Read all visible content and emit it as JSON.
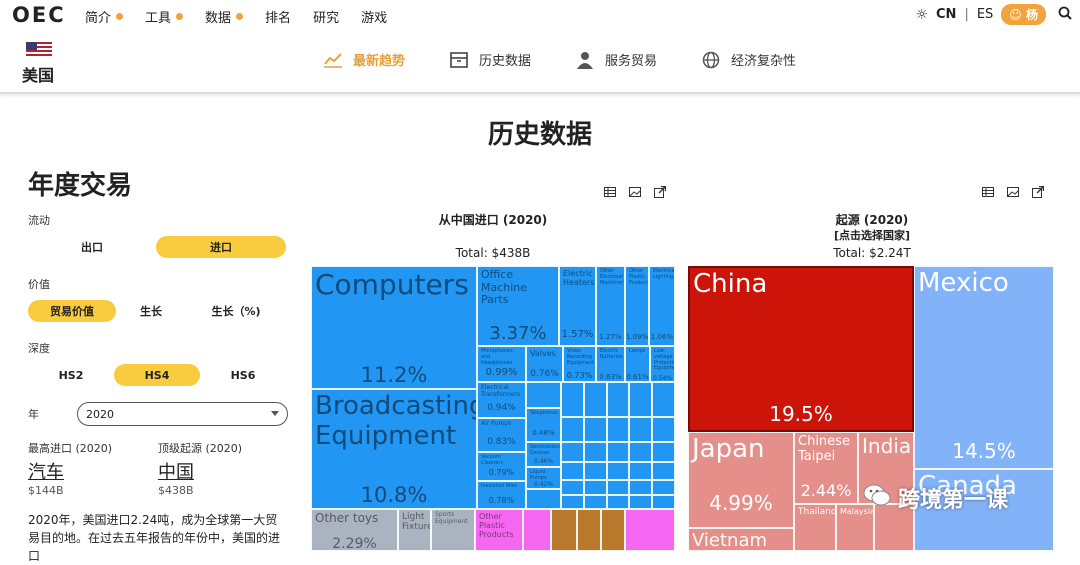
{
  "logo": "OEC",
  "nav": [
    {
      "label": "简介",
      "dot": true
    },
    {
      "label": "工具",
      "dot": true
    },
    {
      "label": "数据",
      "dot": true
    },
    {
      "label": "排名",
      "dot": false
    },
    {
      "label": "研究",
      "dot": false
    },
    {
      "label": "游戏",
      "dot": false
    }
  ],
  "lang": {
    "current": "CN",
    "sep": "|",
    "other": "ES"
  },
  "user": {
    "label": "杨"
  },
  "country": {
    "name": "美国"
  },
  "tabs": [
    {
      "label": "最新趋势",
      "icon": "trend-chart-icon",
      "active": true
    },
    {
      "label": "历史数据",
      "icon": "archive-box-icon",
      "active": false
    },
    {
      "label": "服务贸易",
      "icon": "person-icon",
      "active": false
    },
    {
      "label": "经济复杂性",
      "icon": "globe-icon",
      "active": false
    }
  ],
  "page_title": "历史数据",
  "sidebar": {
    "heading": "年度交易",
    "flow_label": "流动",
    "flow_options": [
      "出口",
      "进口"
    ],
    "value_label": "价值",
    "value_options": [
      "贸易价值",
      "生长",
      "生长（%)"
    ],
    "depth_label": "深度",
    "depth_options": [
      "HS2",
      "HS4",
      "HS6"
    ],
    "year_label": "年",
    "year_value": "2020",
    "top_import_label": "最高进口 (2020)",
    "top_import_value": "汽车",
    "top_import_amount": "$144B",
    "top_origin_label": "顶级起源 (2020)",
    "top_origin_value": "中国",
    "top_origin_amount": "$438B",
    "paragraph": "2020年，美国进口2.24吨，成为全球第一大贸易目的地。在过去五年报告的年份中，美国的进口"
  },
  "chart1": {
    "title": "从中国进口 (2020)",
    "total": "Total: $438B"
  },
  "chart2": {
    "title": "起源 (2020)",
    "subtitle": "[点击选择国家]",
    "total": "Total: $2.24T"
  },
  "chart_data": [
    {
      "type": "treemap",
      "title": "从中国进口 (2020)",
      "total": "Total: $438B",
      "items": [
        {
          "label": "Computers",
          "value": "11.2%"
        },
        {
          "label": "Broadcasting Equipment",
          "value": "10.8%"
        },
        {
          "label": "Office Machine Parts",
          "value": "3.37%"
        },
        {
          "label": "Electric Heaters",
          "value": "1.57%"
        },
        {
          "label": "Other Electrical Machinery",
          "value": "1.27%"
        },
        {
          "label": "Other Plastic Products",
          "value": "1.09%"
        },
        {
          "label": "Electrical Lighting",
          "value": "1.06%"
        },
        {
          "label": "Microphones and Headphones",
          "value": "0.99%"
        },
        {
          "label": "Valves",
          "value": "0.76%"
        },
        {
          "label": "Video Recording Equipment",
          "value": "0.73%"
        },
        {
          "label": "Electric Batteries",
          "value": "0.63%"
        },
        {
          "label": "Lamps",
          "value": "0.61%"
        },
        {
          "label": "Low-voltage Protection Equipment",
          "value": "0.54%"
        },
        {
          "label": "Electrical Transformers",
          "value": "0.94%"
        },
        {
          "label": "Air Pumps",
          "value": "0.83%"
        },
        {
          "label": "Vacuum Cleaners",
          "value": "0.79%"
        },
        {
          "label": "Insulated Wire",
          "value": "0.78%"
        },
        {
          "label": "Telephones",
          "value": "0.48%"
        },
        {
          "label": "Semiconductor Devices",
          "value": "0.46%"
        },
        {
          "label": "Liquid Pumps",
          "value": "0.42%"
        },
        {
          "label": "Other toys",
          "value": "2.29%"
        },
        {
          "label": "Light Fixtures",
          "value": ""
        },
        {
          "label": "Sports Equipment",
          "value": ""
        },
        {
          "label": "Other Plastic Products",
          "value": ""
        }
      ]
    },
    {
      "type": "treemap",
      "title": "起源 (2020)",
      "total": "Total: $2.24T",
      "items": [
        {
          "label": "China",
          "value": "19.5%"
        },
        {
          "label": "Mexico",
          "value": "14.5%"
        },
        {
          "label": "Canada",
          "value": ""
        },
        {
          "label": "Japan",
          "value": "4.99%"
        },
        {
          "label": "Chinese Taipei",
          "value": "2.44%"
        },
        {
          "label": "India",
          "value": ""
        },
        {
          "label": "Vietnam",
          "value": ""
        },
        {
          "label": "Thailand",
          "value": ""
        },
        {
          "label": "Malaysia",
          "value": ""
        }
      ]
    }
  ],
  "watermark": "跨境第一课",
  "colors": {
    "accent": "#f2a33a",
    "toggle": "#f9cb3f",
    "electronics": "#2196f3",
    "china": "#cc1408",
    "americas": "#82b2f7",
    "asia": "#e58f8a"
  }
}
